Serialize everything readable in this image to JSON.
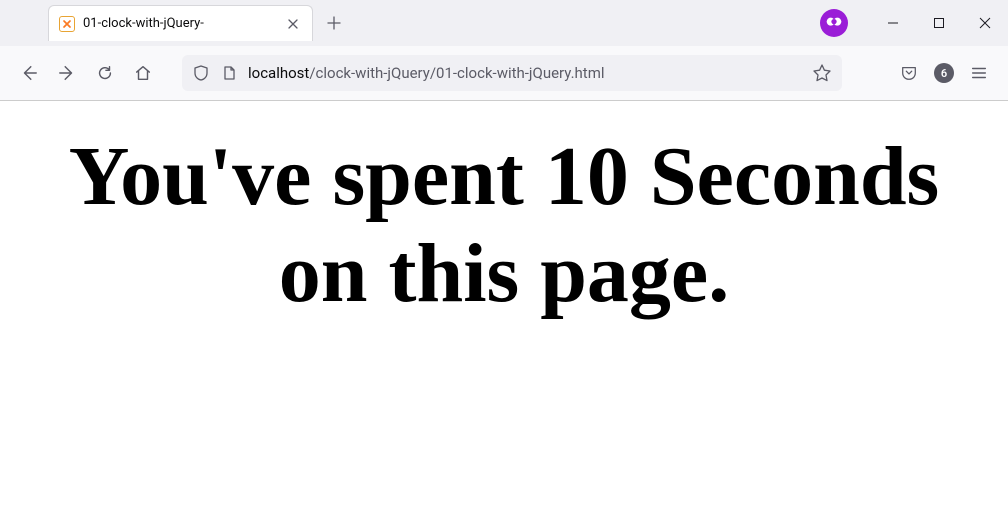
{
  "tab": {
    "title": "01-clock-with-jQuery-"
  },
  "url": {
    "host": "localhost",
    "path": "/clock-with-jQuery/01-clock-with-jQuery.html"
  },
  "badge": {
    "count": "6"
  },
  "page": {
    "heading": "You've spent 10 Seconds on this page."
  }
}
